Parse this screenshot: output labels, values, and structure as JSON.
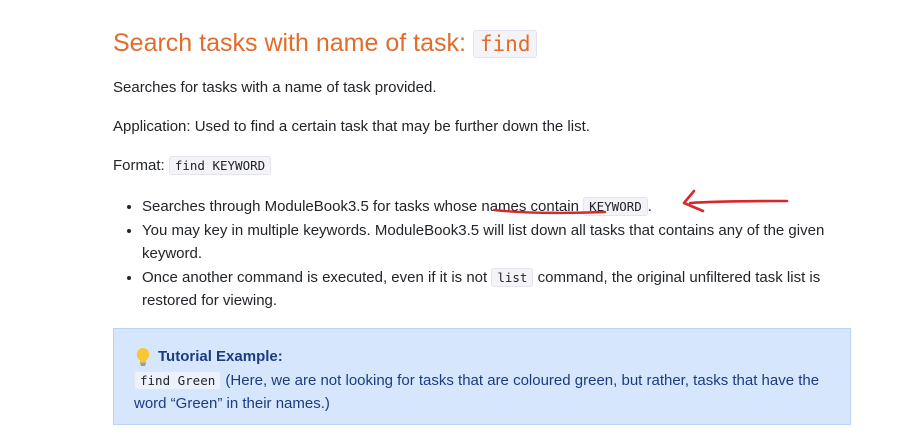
{
  "section": {
    "title": "Search tasks with name of task: ",
    "title_code": "find"
  },
  "description": "Searches for tasks with a name of task provided.",
  "application": "Application: Used to find a certain task that may be further down the list.",
  "format": {
    "label": "Format: ",
    "code": "find KEYWORD"
  },
  "bullets": {
    "b1_text": "Searches through ModuleBook3.5 for tasks whose names contain ",
    "b1_code": "KEYWORD",
    "b1_end": ".",
    "b2_text": "You may key in multiple keywords. ModuleBook3.5 will list down all tasks that contains any of the given keyword.",
    "b3_text_before": "Once another command is executed, even if it is not ",
    "b3_code": "list",
    "b3_text_after": " command, the original unfiltered task list is restored for viewing."
  },
  "tutorial": {
    "icon": "lightbulb-icon",
    "title": "Tutorial Example:",
    "code": "find Green",
    "text": " (Here, we are not looking for tasks that are coloured green, but rather, tasks that have the word “Green” in their names.)"
  },
  "colors": {
    "heading": "#e46c2a",
    "callout_bg": "#d6e6fc",
    "callout_text": "#1b3c80",
    "annotation": "#d9272e"
  }
}
